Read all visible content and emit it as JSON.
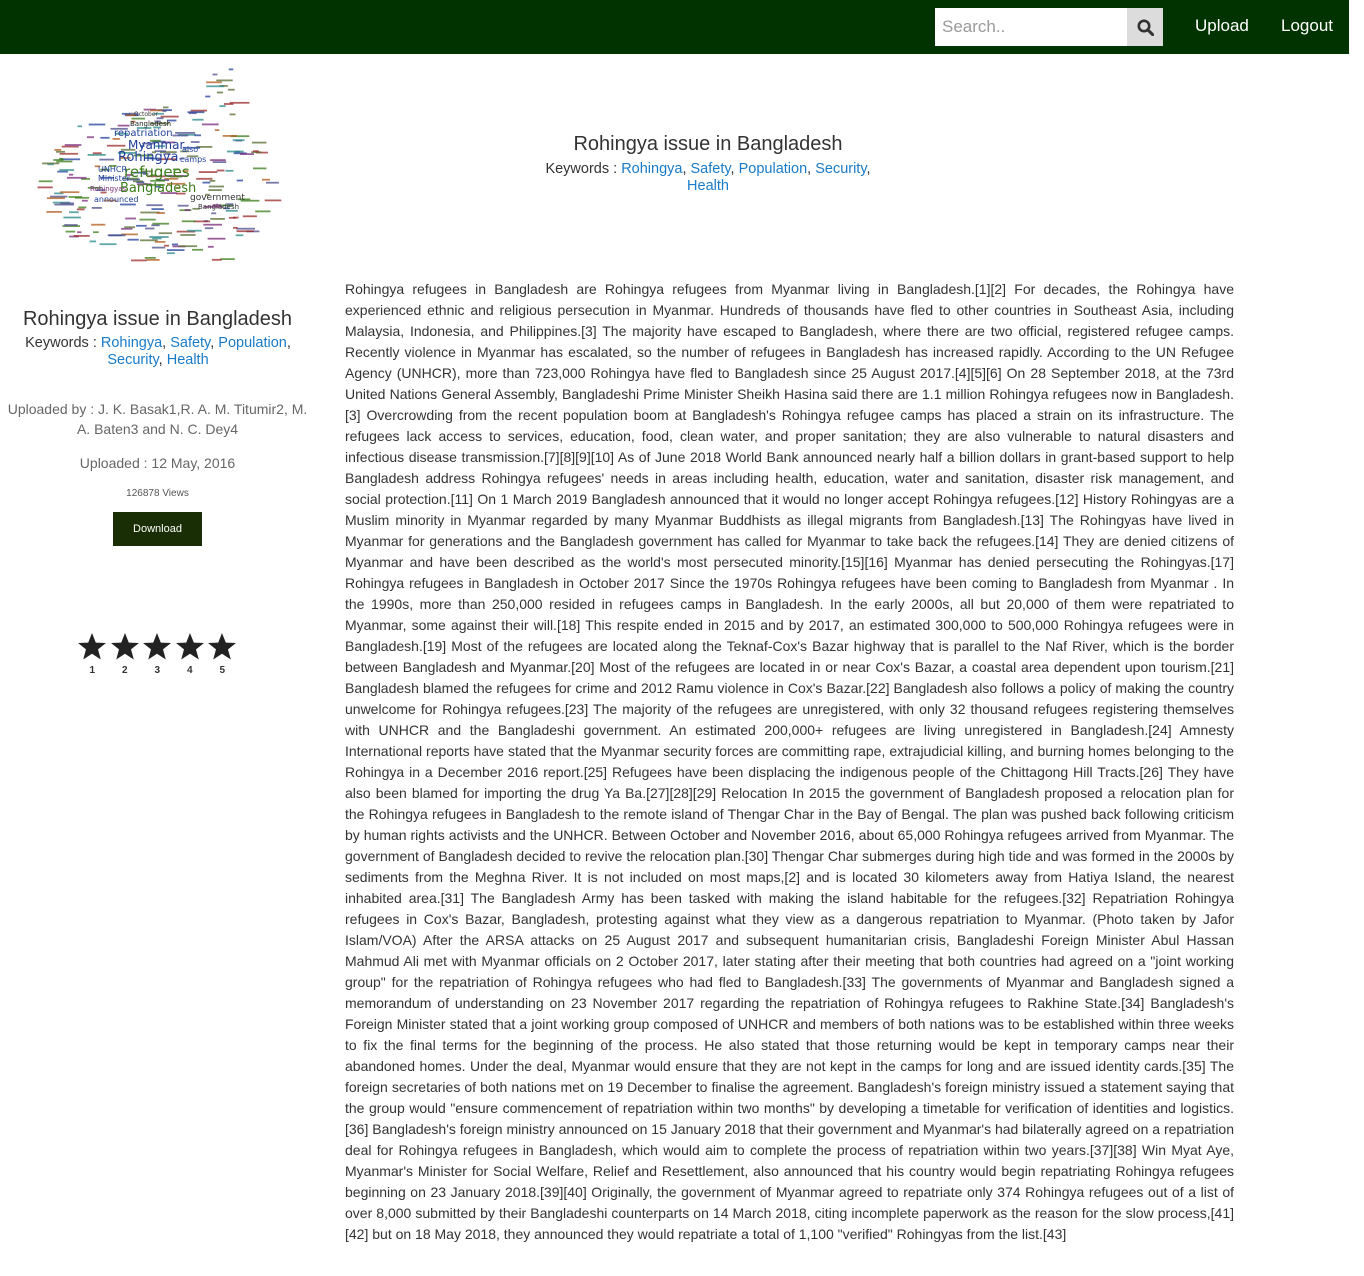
{
  "header": {
    "search_placeholder": "Search..",
    "search_icon": "magnifier-icon",
    "upload_label": "Upload",
    "logout_label": "Logout",
    "bar_color": "#003300"
  },
  "wordcloud_words": [
    "Bangladesh",
    "repatriation",
    "Myanmar",
    "Rohingya",
    "refugees",
    "Bangladesh",
    "government",
    "UNHCR",
    "Minister",
    "camps",
    "also",
    "announced",
    "October",
    "Bangladesh",
    "Rohingyas"
  ],
  "document": {
    "title": "Rohingya issue in Bangladesh",
    "keywords_label": "Keywords : ",
    "keywords": [
      "Rohingya",
      "Safety",
      "Population",
      "Security",
      "Health"
    ],
    "uploaded_by_label": "Uploaded by : ",
    "uploaded_by": "J. K. Basak1,R. A. M. Titumir2, M. A. Baten3 and N. C. Dey4",
    "uploaded_label": "Uploaded : ",
    "uploaded_date": "12 May, 2016",
    "views": "126878 Views",
    "download_label": "Download",
    "rating_labels": [
      "1",
      "2",
      "3",
      "4",
      "5"
    ],
    "body": "Rohingya refugees in Bangladesh are Rohingya refugees from Myanmar living in Bangladesh.[1][2] For decades, the Rohingya have experienced ethnic and religious persecution in Myanmar. Hundreds of thousands have fled to other countries in Southeast Asia, including Malaysia, Indonesia, and Philippines.[3] The majority have escaped to Bangladesh, where there are two official, registered refugee camps. Recently violence in Myanmar has escalated, so the number of refugees in Bangladesh has increased rapidly. According to the UN Refugee Agency (UNHCR), more than 723,000 Rohingya have fled to Bangladesh since 25 August 2017.[4][5][6] On 28 September 2018, at the 73rd United Nations General Assembly, Bangladeshi Prime Minister Sheikh Hasina said there are 1.1 million Rohingya refugees now in Bangladesh.[3] Overcrowding from the recent population boom at Bangladesh's Rohingya refugee camps has placed a strain on its infrastructure. The refugees lack access to services, education, food, clean water, and proper sanitation; they are also vulnerable to natural disasters and infectious disease transmission.[7][8][9][10] As of June 2018 World Bank announced nearly half a billion dollars in grant-based support to help Bangladesh address Rohingya refugees' needs in areas including health, education, water and sanitation, disaster risk management, and social protection.[11] On 1 March 2019 Bangladesh announced that it would no longer accept Rohingya refugees.[12] History Rohingyas are a Muslim minority in Myanmar regarded by many Myanmar Buddhists as illegal migrants from Bangladesh.[13] The Rohingyas have lived in Myanmar for generations and the Bangladesh government has called for Myanmar to take back the refugees.[14] They are denied citizens of Myanmar and have been described as the world's most persecuted minority.[15][16] Myanmar has denied persecuting the Rohingyas.[17] Rohingya refugees in Bangladesh in October 2017 Since the 1970s Rohingya refugees have been coming to Bangladesh from Myanmar . In the 1990s, more than 250,000 resided in refugees camps in Bangladesh. In the early 2000s, all but 20,000 of them were repatriated to Myanmar, some against their will.[18] This respite ended in 2015 and by 2017, an estimated 300,000 to 500,000 Rohingya refugees were in Bangladesh.[19] Most of the refugees are located along the Teknaf-Cox's Bazar highway that is parallel to the Naf River, which is the border between Bangladesh and Myanmar.[20] Most of the refugees are located in or near Cox's Bazar, a coastal area dependent upon tourism.[21] Bangladesh blamed the refugees for crime and 2012 Ramu violence in Cox's Bazar.[22] Bangladesh also follows a policy of making the country unwelcome for Rohingya refugees.[23] The majority of the refugees are unregistered, with only 32 thousand refugees registering themselves with UNHCR and the Bangladeshi government. An estimated 200,000+ refugees are living unregistered in Bangladesh.[24] Amnesty International reports have stated that the Myanmar security forces are committing rape, extrajudicial killing, and burning homes belonging to the Rohingya in a December 2016 report.[25] Refugees have been displacing the indigenous people of the Chittagong Hill Tracts.[26] They have also been blamed for importing the drug Ya Ba.[27][28][29] Relocation In 2015 the government of Bangladesh proposed a relocation plan for the Rohingya refugees in Bangladesh to the remote island of Thengar Char in the Bay of Bengal. The plan was pushed back following criticism by human rights activists and the UNHCR. Between October and November 2016, about 65,000 Rohingya refugees arrived from Myanmar. The government of Bangladesh decided to revive the relocation plan.[30] Thengar Char submerges during high tide and was formed in the 2000s by sediments from the Meghna River. It is not included on most maps,[2] and is located 30 kilometers away from Hatiya Island, the nearest inhabited area.[31] The Bangladesh Army has been tasked with making the island habitable for the refugees.[32] Repatriation Rohingya refugees in Cox's Bazar, Bangladesh, protesting against what they view as a dangerous repatriation to Myanmar. (Photo taken by Jafor Islam/VOA) After the ARSA attacks on 25 August 2017 and subsequent humanitarian crisis, Bangladeshi Foreign Minister Abul Hassan Mahmud Ali met with Myanmar officials on 2 October 2017, later stating after their meeting that both countries had agreed on a \"joint working group\" for the repatriation of Rohingya refugees who had fled to Bangladesh.[33] The governments of Myanmar and Bangladesh signed a memorandum of understanding on 23 November 2017 regarding the repatriation of Rohingya refugees to Rakhine State.[34] Bangladesh's Foreign Minister stated that a joint working group composed of UNHCR and members of both nations was to be established within three weeks to fix the final terms for the beginning of the process. He also stated that those returning would be kept in temporary camps near their abandoned homes. Under the deal, Myanmar would ensure that they are not kept in the camps for long and are issued identity cards.[35] The foreign secretaries of both nations met on 19 December to finalise the agreement. Bangladesh's foreign ministry issued a statement saying that the group would \"ensure commencement of repatriation within two months\" by developing a timetable for verification of identities and logistics.[36] Bangladesh's foreign ministry announced on 15 January 2018 that their government and Myanmar's had bilaterally agreed on a repatriation deal for Rohingya refugees in Bangladesh, which would aim to complete the process of repatriation within two years.[37][38] Win Myat Aye, Myanmar's Minister for Social Welfare, Relief and Resettlement, also announced that his country would begin repatriating Rohingya refugees beginning on 23 January 2018.[39][40] Originally, the government of Myanmar agreed to repatriate only 374 Rohingya refugees out of a list of over 8,000 submitted by their Bangladeshi counterparts on 14 March 2018, citing incomplete paperwork as the reason for the slow process,[41][42] but on 18 May 2018, they announced they would repatriate a total of 1,100 \"verified\" Rohingyas from the list.[43]"
  },
  "colors": {
    "link": "#1a7bc8",
    "download_bg": "#1a2e05",
    "star": "#222222"
  }
}
